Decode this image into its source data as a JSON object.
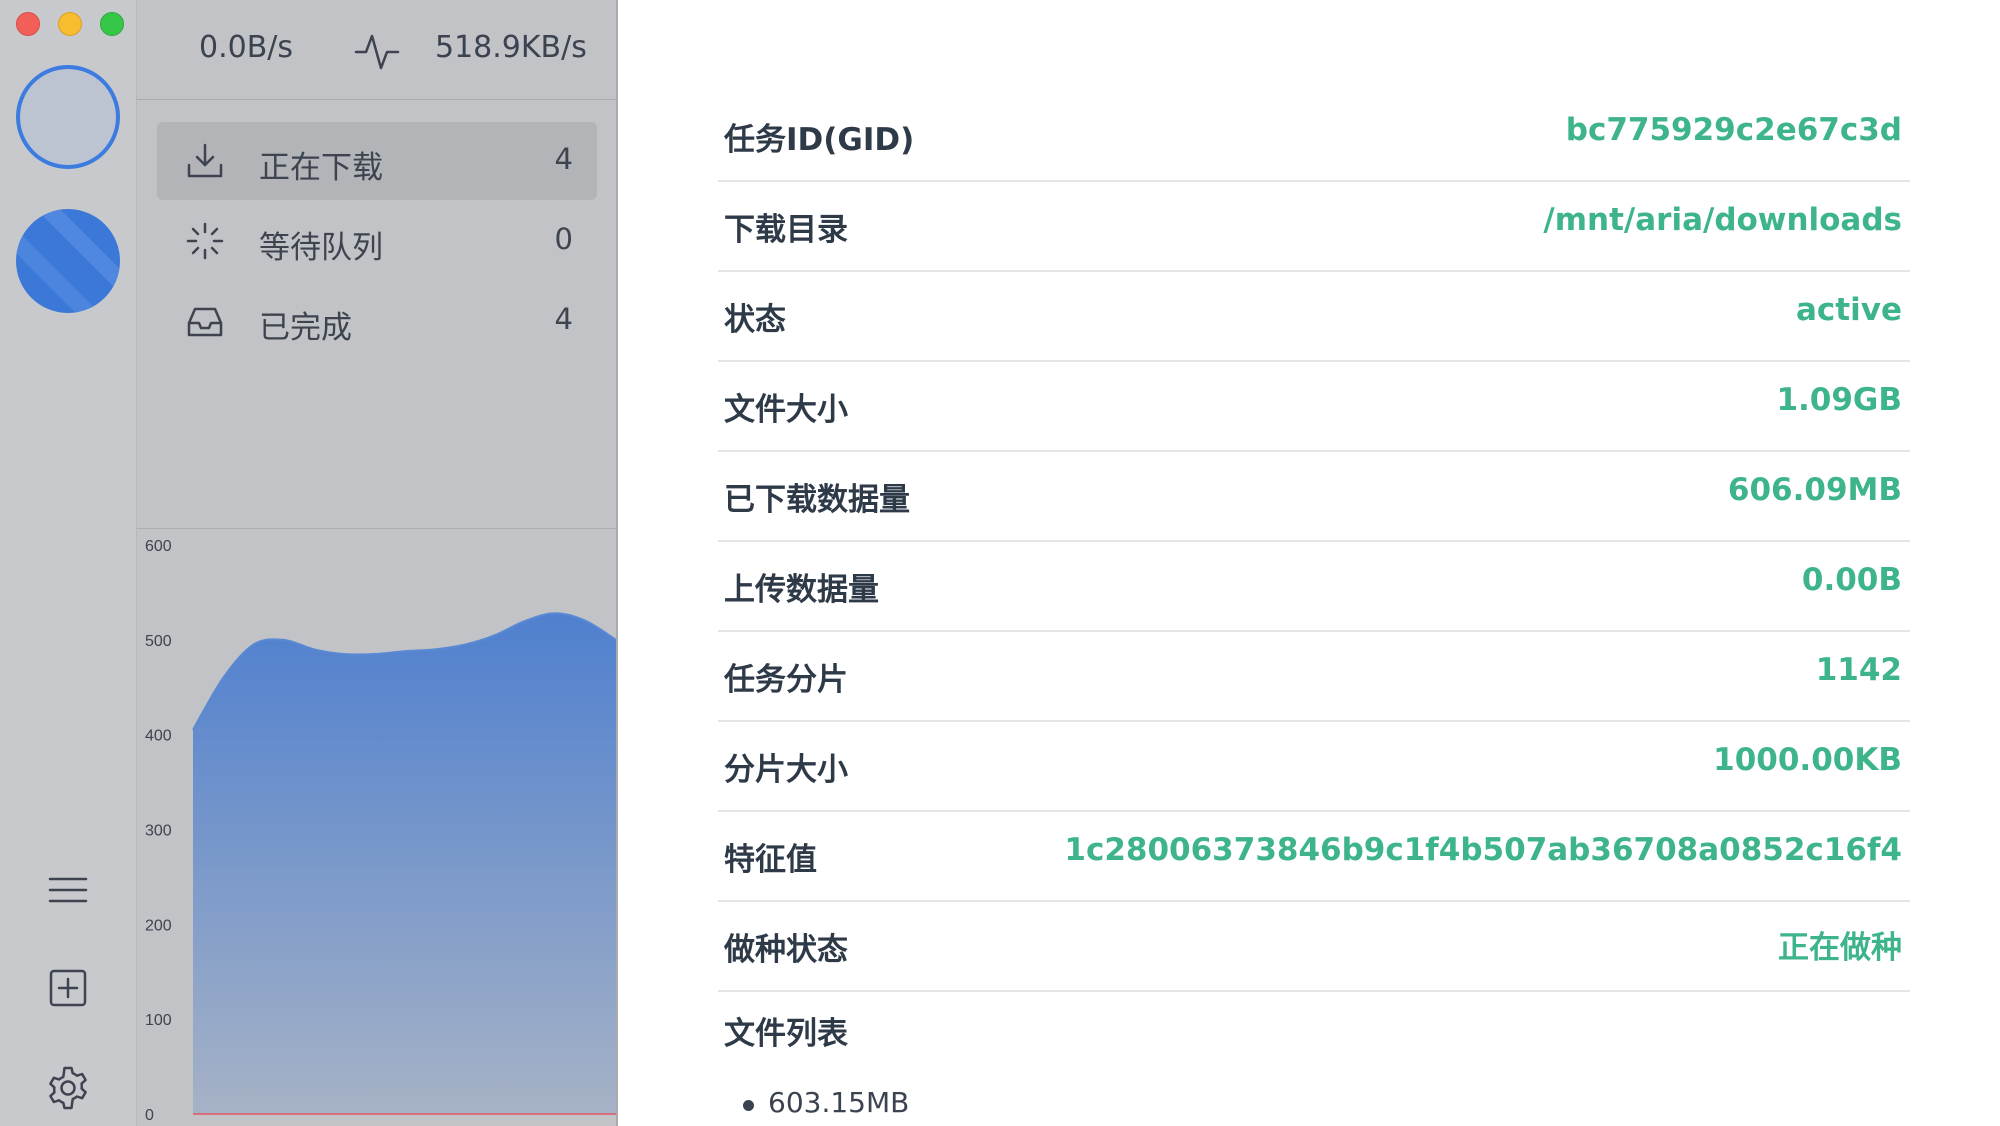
{
  "speeds": {
    "upload": "0.0B/s",
    "download": "518.9KB/s"
  },
  "menu": [
    {
      "label": "正在下载",
      "count": "4",
      "icon": "download-icon",
      "active": true
    },
    {
      "label": "等待队列",
      "count": "0",
      "icon": "loading-spinner-icon",
      "active": false
    },
    {
      "label": "已完成",
      "count": "4",
      "icon": "inbox-icon",
      "active": false
    }
  ],
  "chart_data": {
    "type": "area",
    "title": "",
    "xlabel": "",
    "ylabel": "",
    "ylim": [
      0,
      600
    ],
    "yticks": [
      "600",
      "500",
      "400",
      "300",
      "200",
      "100",
      "0"
    ],
    "series": [
      {
        "values": [
          405,
          460,
          495,
          500,
          490,
          485,
          485,
          488,
          490,
          495,
          505,
          520,
          528,
          520,
          500
        ]
      },
      {
        "values": [
          0,
          0,
          0,
          0,
          0,
          0,
          0,
          0,
          0,
          0,
          0,
          0,
          0,
          0,
          0
        ]
      }
    ],
    "colors": {
      "fill_top": "#4f80cf",
      "fill_bottom": "#a6b2c6",
      "line": "#5a89d4",
      "upload_line": "#e5576a"
    }
  },
  "details": [
    {
      "key": "任务ID(GID)",
      "value": "bc775929c2e67c3d"
    },
    {
      "key": "下载目录",
      "value": "/mnt/aria/downloads"
    },
    {
      "key": "状态",
      "value": "active"
    },
    {
      "key": "文件大小",
      "value": "1.09GB"
    },
    {
      "key": "已下载数据量",
      "value": "606.09MB"
    },
    {
      "key": "上传数据量",
      "value": "0.00B"
    },
    {
      "key": "任务分片",
      "value": "1142"
    },
    {
      "key": "分片大小",
      "value": "1000.00KB"
    },
    {
      "key": "特征值",
      "value": "1c28006373846b9c1f4b507ab36708a0852c16f4"
    },
    {
      "key": "做种状态",
      "value": "正在做种"
    }
  ],
  "files": {
    "title": "文件列表",
    "items": [
      "603.15MB"
    ]
  },
  "colors": {
    "accent_green": "#3db48a",
    "accent_blue": "#3c7be0"
  }
}
